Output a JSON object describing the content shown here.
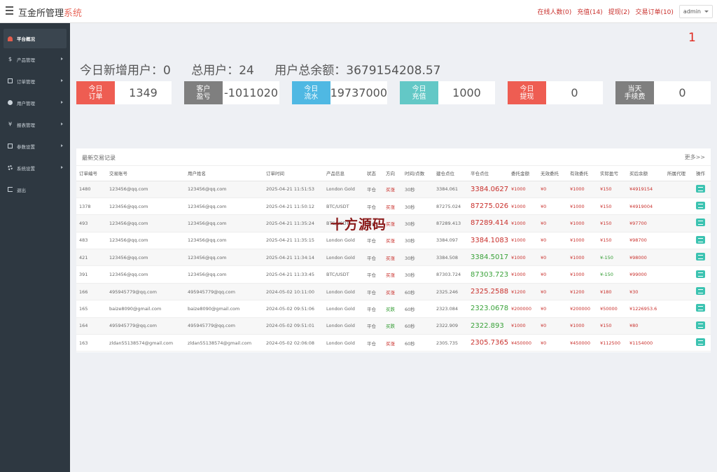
{
  "header": {
    "title_main": "互金所管理",
    "title_accent": "系统",
    "links": [
      "在线人数(0)",
      "充值(14)",
      "提现(2)",
      "交易订单(10)"
    ],
    "admin_label": "admin"
  },
  "sidebar": {
    "items": [
      {
        "label": "平台概况",
        "icon": "dashboard-icon"
      },
      {
        "label": "产品管理",
        "icon": "dollar-icon"
      },
      {
        "label": "订单管理",
        "icon": "document-icon"
      },
      {
        "label": "用户管理",
        "icon": "user-icon"
      },
      {
        "label": "报表管理",
        "icon": "yen-icon"
      },
      {
        "label": "参数设置",
        "icon": "document-icon"
      },
      {
        "label": "系统设置",
        "icon": "gear-icon"
      },
      {
        "label": "退出",
        "icon": "exit-icon"
      }
    ]
  },
  "notice_count": "1",
  "stats": {
    "new_users": "今日新增用户：0",
    "total_users": "总用户：24",
    "total_balance": "用户总余额：3679154208.57"
  },
  "cards": [
    {
      "label": "今日\n订单",
      "value": "1349",
      "color": "#ee5d52"
    },
    {
      "label": "客户\n盈亏",
      "value": "-1011020",
      "color": "#7f7f7f"
    },
    {
      "label": "今日\n流水",
      "value": "19737000",
      "color": "#4fb8e3"
    },
    {
      "label": "今日\n充值",
      "value": "1000",
      "color": "#63c8c6"
    },
    {
      "label": "今日\n提现",
      "value": "0",
      "color": "#ee5d52"
    },
    {
      "label": "当天\n手续费",
      "value": "0",
      "color": "#7f7f7f"
    }
  ],
  "table": {
    "title": "最新交易记录",
    "more": "更多>>",
    "columns": [
      "订单编号",
      "交易账号",
      "用户姓名",
      "订单时间",
      "产品信息",
      "状态",
      "方向",
      "时间/点数",
      "建仓点位",
      "平仓点位",
      "委托金额",
      "无效委托",
      "有效委托",
      "实际盈亏",
      "买后余额",
      "所属代理",
      "操作"
    ],
    "rows": [
      {
        "id": "1480",
        "account": "123456@qq.com",
        "name": "123456@qq.com",
        "time": "2025-04-21 11:51:53",
        "product": "London Gold",
        "status": "平仓",
        "dir": "买涨",
        "dur": "30秒",
        "open": "3384.061",
        "close": "3384.0627",
        "close_up": true,
        "amount": "¥1000",
        "invalid": "¥0",
        "valid": "¥1000",
        "pnl": "¥150",
        "pnl_up": true,
        "balance": "¥4919154",
        "agent": ""
      },
      {
        "id": "1378",
        "account": "123456@qq.com",
        "name": "123456@qq.com",
        "time": "2025-04-21 11:50:12",
        "product": "BTC/USDT",
        "status": "平仓",
        "dir": "买涨",
        "dur": "30秒",
        "open": "87275.024",
        "close": "87275.026",
        "close_up": true,
        "amount": "¥1000",
        "invalid": "¥0",
        "valid": "¥1000",
        "pnl": "¥150",
        "pnl_up": true,
        "balance": "¥4919004",
        "agent": ""
      },
      {
        "id": "493",
        "account": "123456@qq.com",
        "name": "123456@qq.com",
        "time": "2025-04-21 11:35:24",
        "product": "BTC/USDT",
        "status": "平仓",
        "dir": "买涨",
        "dur": "30秒",
        "open": "87289.413",
        "close": "87289.414",
        "close_up": true,
        "amount": "¥1000",
        "invalid": "¥0",
        "valid": "¥1000",
        "pnl": "¥150",
        "pnl_up": true,
        "balance": "¥97700",
        "agent": ""
      },
      {
        "id": "483",
        "account": "123456@qq.com",
        "name": "123456@qq.com",
        "time": "2025-04-21 11:35:15",
        "product": "London Gold",
        "status": "平仓",
        "dir": "买涨",
        "dur": "30秒",
        "open": "3384.097",
        "close": "3384.1083",
        "close_up": true,
        "amount": "¥1000",
        "invalid": "¥0",
        "valid": "¥1000",
        "pnl": "¥150",
        "pnl_up": true,
        "balance": "¥98700",
        "agent": ""
      },
      {
        "id": "421",
        "account": "123456@qq.com",
        "name": "123456@qq.com",
        "time": "2025-04-21 11:34:14",
        "product": "London Gold",
        "status": "平仓",
        "dir": "买涨",
        "dur": "30秒",
        "open": "3384.508",
        "close": "3384.5017",
        "close_up": false,
        "amount": "¥1000",
        "invalid": "¥0",
        "valid": "¥1000",
        "pnl": "¥-150",
        "pnl_up": false,
        "balance": "¥98000",
        "agent": ""
      },
      {
        "id": "391",
        "account": "123456@qq.com",
        "name": "123456@qq.com",
        "time": "2025-04-21 11:33:45",
        "product": "BTC/USDT",
        "status": "平仓",
        "dir": "买涨",
        "dur": "30秒",
        "open": "87303.724",
        "close": "87303.723",
        "close_up": false,
        "amount": "¥1000",
        "invalid": "¥0",
        "valid": "¥1000",
        "pnl": "¥-150",
        "pnl_up": false,
        "balance": "¥99000",
        "agent": ""
      },
      {
        "id": "166",
        "account": "495945779@qq.com",
        "name": "495945779@qq.com",
        "time": "2024-05-02 10:11:00",
        "product": "London Gold",
        "status": "平仓",
        "dir": "买涨",
        "dur": "60秒",
        "open": "2325.246",
        "close": "2325.2588",
        "close_up": true,
        "amount": "¥1200",
        "invalid": "¥0",
        "valid": "¥1200",
        "pnl": "¥180",
        "pnl_up": true,
        "balance": "¥30",
        "agent": ""
      },
      {
        "id": "165",
        "account": "baize8090@gmail.com",
        "name": "baize8090@gmail.com",
        "time": "2024-05-02 09:51:06",
        "product": "London Gold",
        "status": "平仓",
        "dir": "买跌",
        "dur": "60秒",
        "open": "2323.084",
        "close": "2323.0678",
        "close_up": false,
        "amount": "¥200000",
        "invalid": "¥0",
        "valid": "¥200000",
        "pnl": "¥50000",
        "pnl_up": true,
        "balance": "¥1226953.6",
        "agent": ""
      },
      {
        "id": "164",
        "account": "495945779@qq.com",
        "name": "495945779@qq.com",
        "time": "2024-05-02 09:51:01",
        "product": "London Gold",
        "status": "平仓",
        "dir": "买跌",
        "dur": "60秒",
        "open": "2322.909",
        "close": "2322.893",
        "close_up": false,
        "amount": "¥1000",
        "invalid": "¥0",
        "valid": "¥1000",
        "pnl": "¥150",
        "pnl_up": true,
        "balance": "¥80",
        "agent": ""
      },
      {
        "id": "163",
        "account": "zldan55138574@gmail.com",
        "name": "zldan55138574@gmail.com",
        "time": "2024-05-02 02:06:08",
        "product": "London Gold",
        "status": "平仓",
        "dir": "买涨",
        "dur": "60秒",
        "open": "2305.735",
        "close": "2305.7365",
        "close_up": true,
        "amount": "¥450000",
        "invalid": "¥0",
        "valid": "¥450000",
        "pnl": "¥112500",
        "pnl_up": true,
        "balance": "¥1154000",
        "agent": ""
      }
    ]
  },
  "watermark": "十方源码"
}
